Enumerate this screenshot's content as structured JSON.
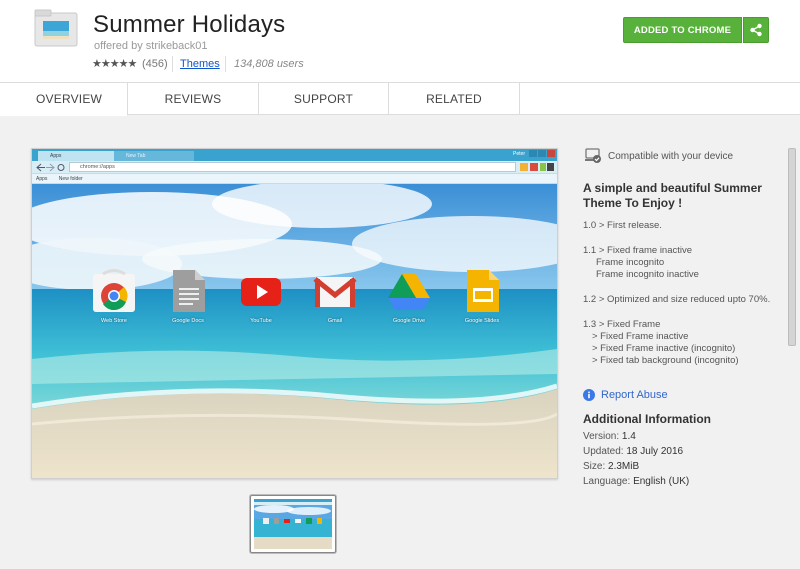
{
  "header": {
    "title": "Summer Holidays",
    "offered_by": "offered by strikeback01",
    "stars": "★★★★★",
    "rating_count": "(456)",
    "category_link": "Themes",
    "users": "134,808 users",
    "add_button": "ADDED TO CHROME",
    "share_icon": "share-icon",
    "accent_color": "#58b13a"
  },
  "tabs": [
    {
      "label": "OVERVIEW",
      "active": true
    },
    {
      "label": "REVIEWS"
    },
    {
      "label": "SUPPORT"
    },
    {
      "label": "RELATED"
    }
  ],
  "screenshot": {
    "tab1": "Apps",
    "tab2": "New Tab",
    "user": "Peter",
    "url": "chrome://apps",
    "bookmarks_apps": "Apps",
    "bookmarks_folder": "New folder",
    "apps": [
      {
        "label": "Web Store",
        "icon": "chrome-web-store-icon"
      },
      {
        "label": "Google Docs",
        "icon": "google-docs-icon"
      },
      {
        "label": "YouTube",
        "icon": "youtube-icon"
      },
      {
        "label": "Gmail",
        "icon": "gmail-icon"
      },
      {
        "label": "Google Drive",
        "icon": "google-drive-icon"
      },
      {
        "label": "Google Slides",
        "icon": "google-slides-icon"
      }
    ]
  },
  "sidebar": {
    "compat": "Compatible with your device",
    "desc_title": "A simple and beautiful Summer Theme To Enjoy !",
    "notes": {
      "n1": "1.0 > First release.",
      "n2a": "1.1 > Fixed frame inactive",
      "n2b": "Frame incognito",
      "n2c": "Frame incognito inactive",
      "n3": "1.2 > Optimized and size reduced upto 70%.",
      "n4a": "1.3 > Fixed Frame",
      "n4b": "> Fixed Frame inactive",
      "n4c": "> Fixed Frame inactive (incognito)",
      "n4d": "> Fixed tab background (incognito)"
    },
    "report_abuse": "Report Abuse",
    "additional_title": "Additional Information",
    "version_label": "Version:",
    "version": "1.4",
    "updated_label": "Updated:",
    "updated": "18 July 2016",
    "size_label": "Size:",
    "size": "2.3MiB",
    "language_label": "Language:",
    "language": "English (UK)"
  }
}
